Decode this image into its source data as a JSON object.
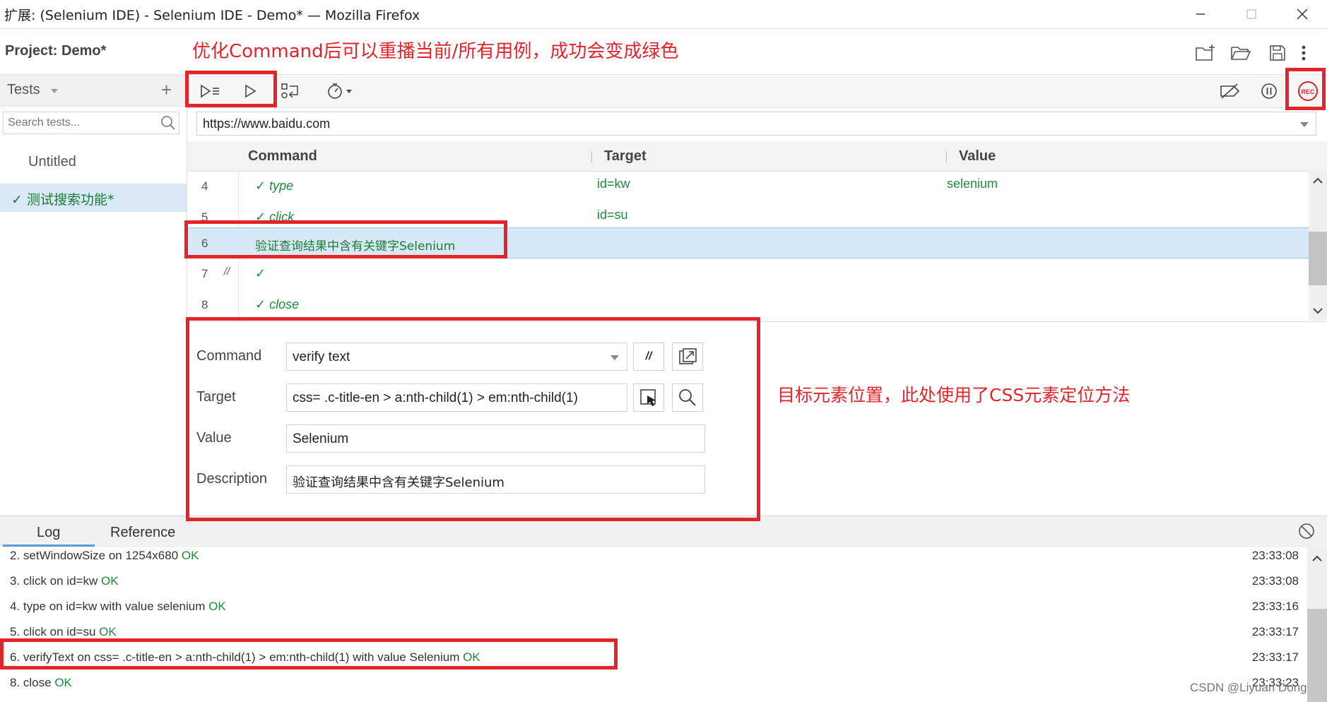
{
  "window": {
    "title": "扩展: (Selenium IDE) - Selenium IDE - Demo* — Mozilla Firefox"
  },
  "header": {
    "project_label": "Project:  Demo*",
    "annotation": "优化Command后可以重播当前/所有用例，成功会变成绿色"
  },
  "sidebar": {
    "tests_label": "Tests",
    "search_placeholder": "Search tests...",
    "items": [
      {
        "label": "Untitled"
      },
      {
        "label": "✓ 测试搜索功能*"
      }
    ]
  },
  "url": {
    "value": "https://www.baidu.com"
  },
  "table": {
    "headers": {
      "command": "Command",
      "target": "Target",
      "value": "Value"
    },
    "rows": [
      {
        "num": "4",
        "command": "✓ type",
        "target": "id=kw",
        "value": "selenium"
      },
      {
        "num": "5",
        "command": "✓ click",
        "target": "id=su",
        "value": ""
      },
      {
        "num": "6",
        "command": "验证查询结果中含有关键字Selenium",
        "target": "",
        "value": ""
      },
      {
        "num": "7",
        "comment": "//",
        "command": "✓",
        "target": "",
        "value": ""
      },
      {
        "num": "8",
        "command": "✓ close",
        "target": "",
        "value": ""
      }
    ]
  },
  "editor": {
    "command_label": "Command",
    "command_value": "verify text",
    "target_label": "Target",
    "target_value": "css= .c-title-en > a:nth-child(1) > em:nth-child(1)",
    "value_label": "Value",
    "value_value": "Selenium",
    "description_label": "Description",
    "description_value": "验证查询结果中含有关键字Selenium",
    "comment_button": "//",
    "annotation": "目标元素位置，此处使用了CSS元素定位方法"
  },
  "log_tabs": {
    "log": "Log",
    "reference": "Reference"
  },
  "log": [
    {
      "msg": "2.   setWindowSize on 1254x680 ",
      "status": "OK",
      "time": "23:33:08"
    },
    {
      "msg": "3.   click on id=kw ",
      "status": "OK",
      "time": "23:33:08"
    },
    {
      "msg": "4.   type on id=kw with value selenium ",
      "status": "OK",
      "time": "23:33:16"
    },
    {
      "msg": "5.   click on id=su ",
      "status": "OK",
      "time": "23:33:17"
    },
    {
      "msg": "6.   verifyText on css= .c-title-en > a:nth-child(1) > em:nth-child(1) with value Selenium ",
      "status": "OK",
      "time": "23:33:17"
    },
    {
      "msg": "8.   close ",
      "status": "OK",
      "time": "23:33:23"
    }
  ],
  "watermark": "CSDN @Liyuan Dong",
  "colors": {
    "annotation_red": "#e3242b",
    "ok_green": "#1f8a3b",
    "selected_row": "#d7e8f7",
    "rec_red": "#d9232a"
  },
  "icons": [
    "minimize-icon",
    "maximize-icon",
    "close-icon",
    "new-project-icon",
    "open-project-icon",
    "save-project-icon",
    "more-icon",
    "run-all-icon",
    "run-current-icon",
    "step-over-icon",
    "speed-icon",
    "disable-breakpoints-icon",
    "pause-icon",
    "record-icon",
    "search-icon",
    "open-window-icon",
    "select-target-icon",
    "find-target-icon",
    "clear-log-icon"
  ]
}
